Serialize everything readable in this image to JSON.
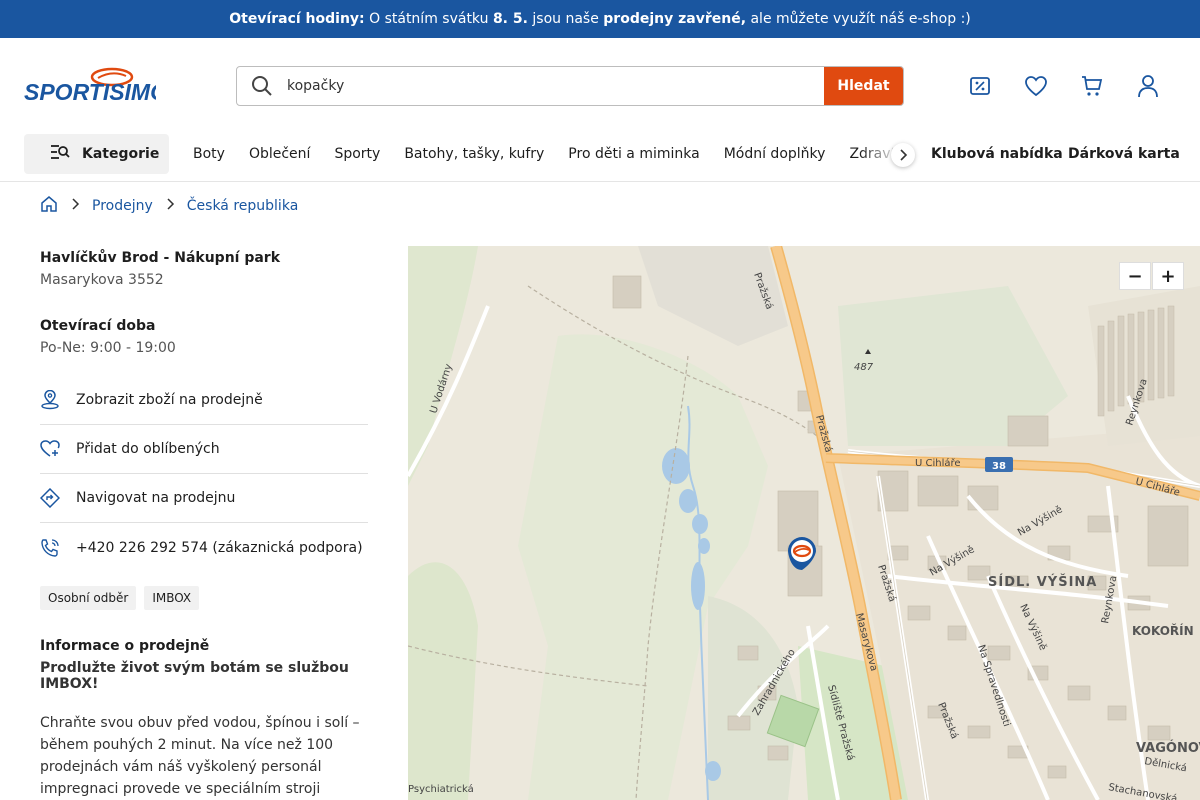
{
  "announcement": {
    "label": "Otevírací hodiny:",
    "text1": "O státním svátku",
    "date": "8. 5.",
    "text2": "jsou naše",
    "closed": "prodejny zavřené,",
    "text3": "ale můžete využít náš e-shop :)"
  },
  "header": {
    "logo_text": "SPORTISIMO",
    "search_value": "kopačky",
    "search_button": "Hledat",
    "icons": [
      "discount-icon",
      "heart-icon",
      "cart-icon",
      "user-icon"
    ]
  },
  "nav": {
    "categories_label": "Kategorie",
    "items": [
      "Boty",
      "Oblečení",
      "Sporty",
      "Batohy, tašky, kufry",
      "Pro děti a miminka",
      "Módní doplňky",
      "Zdraví a výživa"
    ],
    "club": "Klubová nabídka",
    "gift": "Dárková karta"
  },
  "breadcrumb": {
    "stores": "Prodejny",
    "country": "Česká republika"
  },
  "store": {
    "name": "Havlíčkův Brod - Nákupní park",
    "address": "Masarykova 3552",
    "hours_title": "Otevírací doba",
    "hours": "Po-Ne: 9:00 - 19:00",
    "actions": [
      {
        "label": "Zobrazit zboží na prodejně",
        "icon": "store-pin-icon"
      },
      {
        "label": "Přidat do oblíbených",
        "icon": "heart-plus-icon"
      },
      {
        "label": "Navigovat na prodejnu",
        "icon": "navigate-icon"
      },
      {
        "label": "+420 226 292 574 (zákaznická podpora)",
        "icon": "phone-icon"
      }
    ],
    "tags": [
      "Osobní odběr",
      "IMBOX"
    ],
    "info_title": "Informace o prodejně",
    "info_sub": "Prodlužte život svým botám se službou IMBOX!",
    "info_text": "Chraňte svou obuv před vodou, špínou i solí – během pouhých 2 minut. Na více než 100 prodejnách vám náš vyškolený personál impregnaci provede ve speciálním stroji IMBOX, a"
  },
  "map": {
    "zoom_out": "−",
    "zoom_in": "+",
    "labels": [
      "Pražská",
      "Pražská",
      "Pražská",
      "Pražská",
      "487",
      "U Vodárny",
      "U Cihláře",
      "U Cihláře",
      "38",
      "Reynkova",
      "Reynkova",
      "Na Výšině",
      "Na Výšině",
      "Na Výšině",
      "SÍDL. VÝŠINA",
      "KOKOŘÍN",
      "Na Spravedlnosti",
      "Masarykova",
      "Zahradnického",
      "Sídliště Pražská",
      "VAGÓNOVÁ",
      "Dělnická",
      "Stachanovská",
      "Psychiatrická"
    ]
  }
}
